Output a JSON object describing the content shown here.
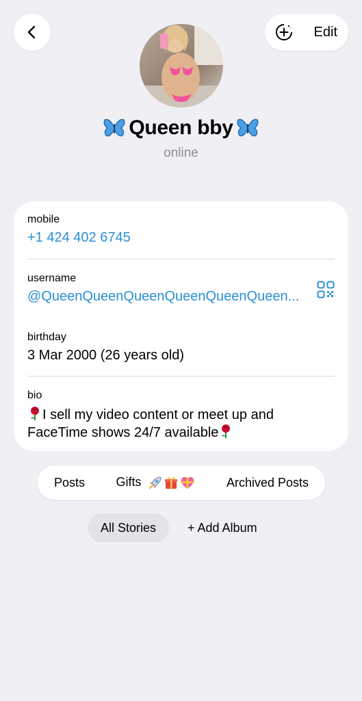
{
  "header": {
    "edit_label": "Edit",
    "icons": [
      "back-chevron-icon",
      "add-circle-icon"
    ]
  },
  "profile": {
    "name": "Queen bby",
    "status": "online",
    "name_decoration_icon": "butterfly-icon"
  },
  "info": {
    "mobile_label": "mobile",
    "mobile_value": "+1 424 402 6745",
    "username_label": "username",
    "username_value": "@QueenQueenQueenQueenQueenQueen...",
    "birthday_label": "birthday",
    "birthday_value": "3 Mar 2000 (26 years old)",
    "bio_label": "bio",
    "bio_line1": "I sell my video content or meet up and",
    "bio_line2": "FaceTime shows 24/7 available",
    "bio_icon": "rose-icon"
  },
  "tabs": {
    "posts": "Posts",
    "gifts": "Gifts",
    "archived": "Archived Posts"
  },
  "stories": {
    "all": "All Stories",
    "add": "+ Add Album"
  },
  "colors": {
    "background": "#efeff4",
    "link": "#2a8fd4",
    "secondary_text": "#8e8e93",
    "butterfly": "#4a9fe6",
    "rose": "#c8102e"
  }
}
